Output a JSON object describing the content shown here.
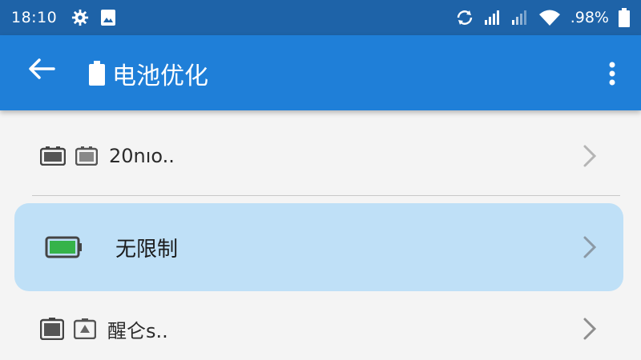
{
  "status_bar": {
    "time": "18:10",
    "battery_text": ".98%",
    "icons_left": [
      "gear-icon",
      "image-icon"
    ],
    "icons_right": [
      "rotation-icon",
      "signal-icon",
      "signal-icon",
      "wifi-icon",
      "battery-icon"
    ]
  },
  "app_bar": {
    "title": "电池优化",
    "title_icon": "battery-icon",
    "background": "#1f7fd8"
  },
  "rows": [
    {
      "label": "20nıo..",
      "icons": [
        "battery-icon",
        "battery-icon"
      ],
      "selected": false
    },
    {
      "label": "无限制",
      "icons": [
        "battery-full-icon"
      ],
      "selected": true,
      "accent": "#35b34a"
    },
    {
      "label": "醒仑s..",
      "icons": [
        "battery-icon",
        "battery-alert-icon"
      ],
      "selected": false
    }
  ],
  "colors": {
    "status_bar": "#1e63a8",
    "selected_row": "#bfe0f7",
    "battery_green": "#35b34a"
  }
}
